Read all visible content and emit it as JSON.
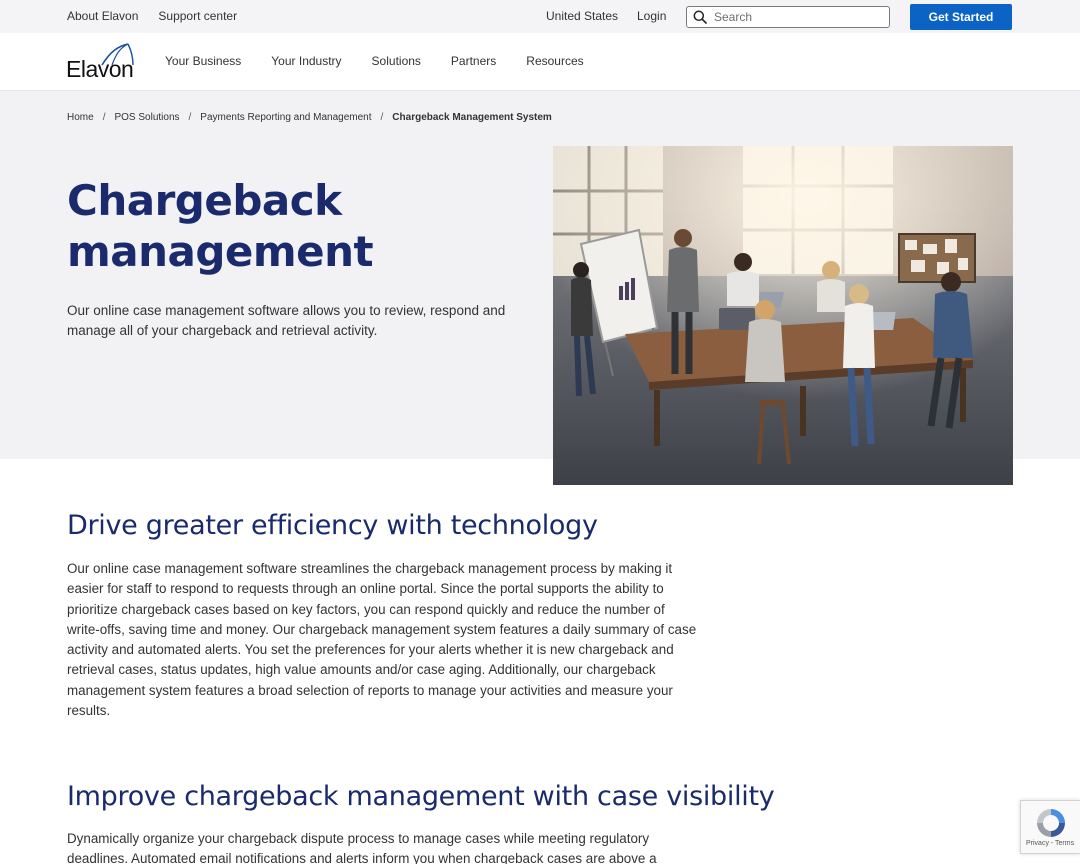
{
  "utility": {
    "about": "About Elavon",
    "support": "Support center",
    "region": "United States",
    "login": "Login",
    "search_placeholder": "Search",
    "cta": "Get Started",
    "cta_color": "#0a63c5"
  },
  "brand": {
    "logo_text": "Elavon"
  },
  "nav": {
    "items": [
      "Your Business",
      "Your Industry",
      "Solutions",
      "Partners",
      "Resources"
    ]
  },
  "breadcrumb": {
    "items": [
      "Home",
      "POS Solutions",
      "Payments Reporting and Management"
    ],
    "current": "Chargeback Management System"
  },
  "hero": {
    "title_line1": "Chargeback",
    "title_line2": "management",
    "intro": "Our online case management software allows you to review, respond and manage all of your chargeback and retrieval activity.",
    "title_color": "#1a2a6c",
    "image": "team meeting around table with whiteboard"
  },
  "sections": [
    {
      "heading": "Drive greater efficiency with technology",
      "body": "Our online case management software streamlines the chargeback management process by making it easier for staff to respond to requests through an online portal. Since the portal supports the ability to prioritize chargeback cases based on key factors, you can respond quickly and reduce the number of write-offs, saving time and money. Our chargeback management system features a daily summary of case activity and automated alerts. You set the preferences for your alerts whether it is new chargeback and retrieval cases, status updates, high value amounts and/or case aging. Additionally, our chargeback management system features a broad selection of reports to manage your activities and measure your results."
    },
    {
      "heading": "Improve chargeback management with case visibility",
      "body": "Dynamically organize your chargeback dispute process to manage cases while meeting regulatory deadlines. Automated email notifications and alerts inform you when chargeback cases are above a"
    }
  ],
  "recaptcha": {
    "text": "Privacy - Terms"
  }
}
